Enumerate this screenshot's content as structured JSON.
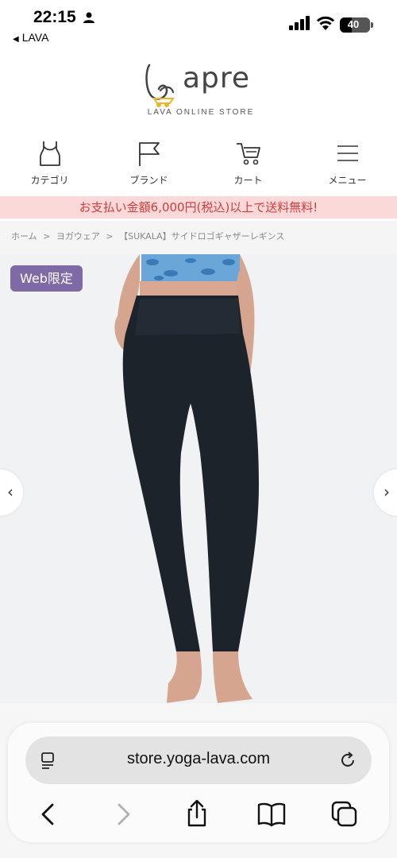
{
  "status_bar": {
    "time": "22:15",
    "back_app": "LAVA",
    "battery": "40",
    "battery_percent": 40
  },
  "logo": {
    "name": "apre",
    "subtitle": "LAVA ONLINE STORE"
  },
  "nav": {
    "items": [
      {
        "label": "カテゴリ",
        "icon": "tank-top-icon"
      },
      {
        "label": "ブランド",
        "icon": "flag-icon"
      },
      {
        "label": "カート",
        "icon": "cart-icon"
      },
      {
        "label": "メニュー",
        "icon": "menu-icon"
      }
    ]
  },
  "banner": {
    "text": "お支払い金額6,000円(税込)以上で送料無料!"
  },
  "breadcrumb": {
    "items": [
      "ホーム",
      ">",
      "ヨガウェア",
      ">",
      "【SUKALA】サイドロゴギャザーレギンス"
    ]
  },
  "product": {
    "badge": "Web限定"
  },
  "browser": {
    "url": "store.yoga-lava.com"
  },
  "colors": {
    "banner_bg": "#fbd9d9",
    "banner_text": "#d23c3c",
    "badge": "#7e6aa6",
    "leggings": "#1c232b"
  }
}
